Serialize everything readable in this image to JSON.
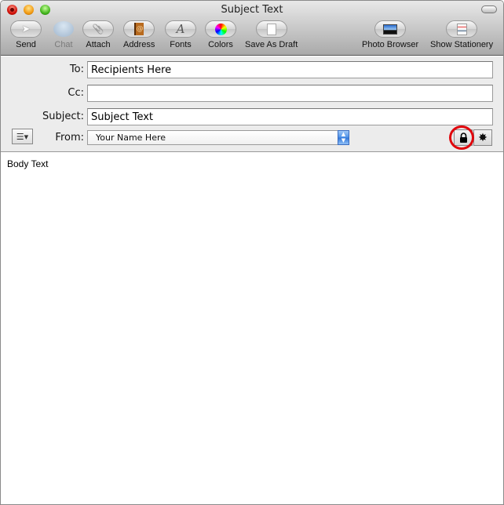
{
  "window": {
    "title": "Subject Text"
  },
  "toolbar": {
    "buttons": [
      {
        "label": "Send",
        "icon": "paper-plane-icon",
        "enabled": true
      },
      {
        "label": "Chat",
        "icon": "chat-bubble-icon",
        "enabled": false
      },
      {
        "label": "Attach",
        "icon": "paperclip-icon",
        "enabled": true
      },
      {
        "label": "Address",
        "icon": "address-book-icon",
        "enabled": true
      },
      {
        "label": "Fonts",
        "icon": "font-icon",
        "enabled": true
      },
      {
        "label": "Colors",
        "icon": "color-wheel-icon",
        "enabled": true
      },
      {
        "label": "Save As Draft",
        "icon": "draft-page-icon",
        "enabled": true
      },
      {
        "label": "Photo Browser",
        "icon": "photo-icon",
        "enabled": true
      },
      {
        "label": "Show Stationery",
        "icon": "stationery-icon",
        "enabled": true
      }
    ],
    "glyphs": {
      "send": "➤",
      "attach": "📎",
      "address": "@",
      "fonts": "A",
      "draft": "▯"
    }
  },
  "header": {
    "to": {
      "label": "To:",
      "value": "Recipients Here"
    },
    "cc": {
      "label": "Cc:",
      "value": ""
    },
    "subject": {
      "label": "Subject:",
      "value": "Subject Text"
    },
    "from": {
      "label": "From:",
      "value": "Your Name Here"
    },
    "list_button_glyph": "☰▾",
    "select_arrows": "▲▼",
    "sign_glyph": "✸"
  },
  "body": {
    "text": "Body Text"
  }
}
